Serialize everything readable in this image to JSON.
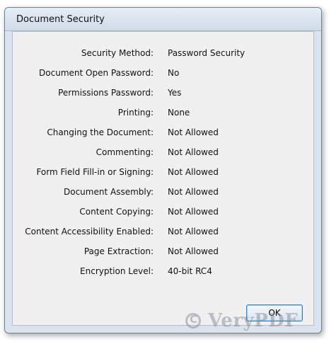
{
  "window": {
    "title": "Document Security"
  },
  "security_rows": [
    {
      "label": "Security Method:",
      "value": "Password Security"
    },
    {
      "label": "Document Open Password:",
      "value": "No"
    },
    {
      "label": "Permissions Password:",
      "value": "Yes"
    },
    {
      "label": "Printing:",
      "value": "None"
    },
    {
      "label": "Changing the Document:",
      "value": "Not Allowed"
    },
    {
      "label": "Commenting:",
      "value": "Not Allowed"
    },
    {
      "label": "Form Field Fill-in or Signing:",
      "value": "Not Allowed"
    },
    {
      "label": "Document Assembly:",
      "value": "Not Allowed"
    },
    {
      "label": "Content Copying:",
      "value": "Not Allowed"
    },
    {
      "label": "Content Accessibility Enabled:",
      "value": "Not Allowed"
    },
    {
      "label": "Page Extraction:",
      "value": "Not Allowed"
    },
    {
      "label": "Encryption Level:",
      "value": "40-bit RC4"
    }
  ],
  "buttons": {
    "ok_label": "OK"
  },
  "watermark": {
    "text": "VeryPDF"
  }
}
